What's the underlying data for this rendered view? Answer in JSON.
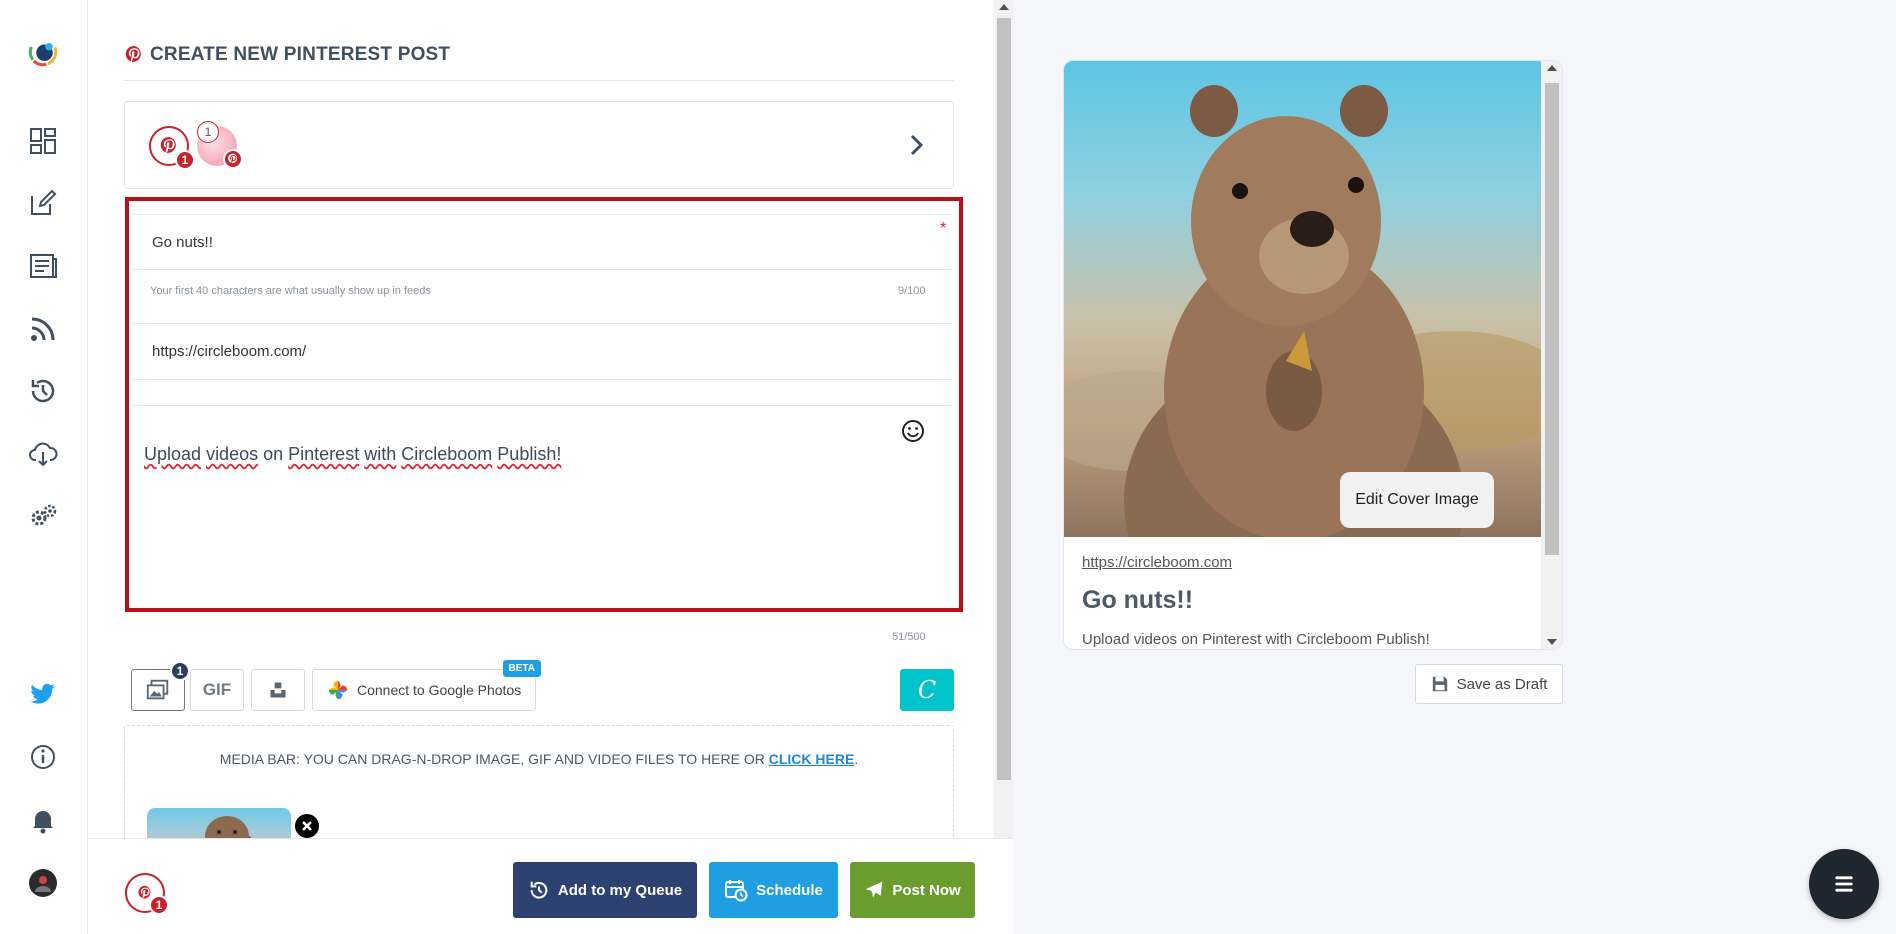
{
  "colors": {
    "pinterest_red": "#c8232c",
    "highlight_border": "#b5121b",
    "queue_button": "#2e4272",
    "schedule_button": "#1f9fe2",
    "post_now_button": "#6a9d2e",
    "canva": "#00c4cc",
    "twitter_blue": "#1da1f2"
  },
  "sidebar": {
    "icons": [
      "circleboom-logo-icon",
      "dashboard-icon",
      "edit-icon",
      "article-icon",
      "rss-icon",
      "history-icon",
      "cloud-download-icon",
      "settings-icon",
      "twitter-icon",
      "info-icon",
      "bell-icon",
      "user-avatar"
    ]
  },
  "editor": {
    "title": "CREATE NEW PINTEREST POST",
    "accounts": {
      "pin_badge": "1",
      "avatar_count": "1"
    },
    "pin_title": {
      "value": "Go nuts!!",
      "required_mark": "*"
    },
    "title_hint": "Your first 40 characters are what usually show up in feeds",
    "title_counter": "9/100",
    "url": {
      "value": "https://circleboom.com/"
    },
    "description": {
      "words": [
        "Upload",
        "videos",
        "on",
        "Pinterest",
        "with",
        "Circleboom",
        "Publish!"
      ]
    },
    "desc_counter": "51/500",
    "media": {
      "image_badge": "1",
      "gif_label": "GIF",
      "google_photos_label": "Connect to Google Photos",
      "beta_label": "BETA",
      "canva_label": "C",
      "bar_text": "MEDIA BAR: YOU CAN DRAG-N-DROP IMAGE, GIF AND VIDEO FILES TO HERE OR ",
      "bar_link": "CLICK HERE",
      "bar_suffix": "."
    }
  },
  "actions": {
    "pin_badge": "1",
    "queue_label": "Add to my Queue",
    "schedule_label": "Schedule",
    "post_now_label": "Post Now"
  },
  "preview": {
    "edit_cover_label": "Edit Cover Image",
    "url": "https://circleboom.com",
    "title": "Go nuts!!",
    "description": "Upload videos on Pinterest with Circleboom Publish!",
    "save_draft_label": "Save as Draft"
  }
}
